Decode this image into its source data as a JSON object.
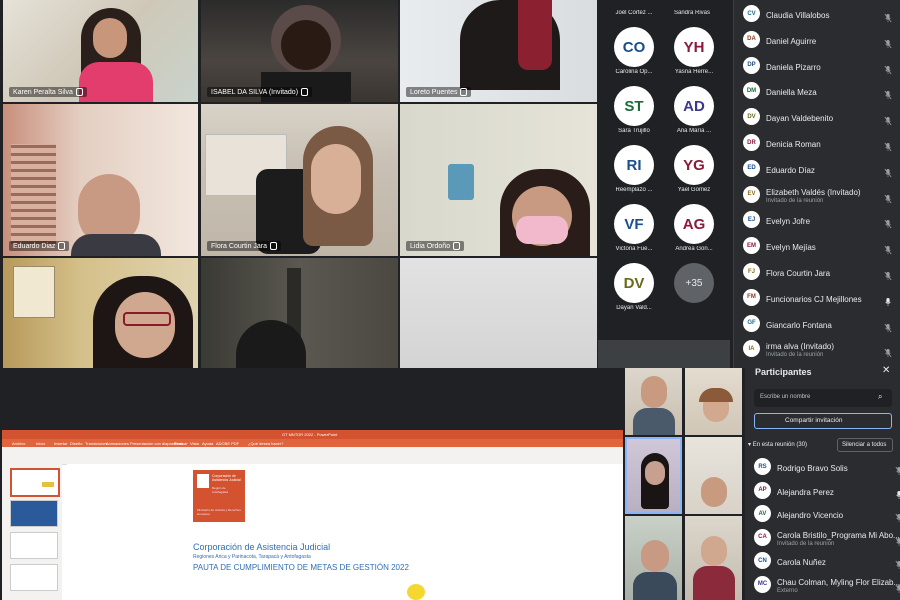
{
  "grid_tiles": [
    {
      "name": "Karen Peralta Silva"
    },
    {
      "name": "ISABEL DA SILVA (Invitado)"
    },
    {
      "name": "Loreto Puentes"
    },
    {
      "name": "Eduardo Diaz"
    },
    {
      "name": "Flora Courtin Jara"
    },
    {
      "name": "Lidia Ordoño"
    },
    {
      "name": ""
    },
    {
      "name": ""
    },
    {
      "name": ""
    }
  ],
  "avatar_grid": [
    {
      "initials": "",
      "label": "Joël Cortez ...",
      "color": "#1a73e8"
    },
    {
      "initials": "",
      "label": "Sandra Rivas",
      "color": "#1a73e8"
    },
    {
      "initials": "CO",
      "label": "Carolina Op...",
      "color": "#1a4f8a"
    },
    {
      "initials": "YH",
      "label": "Yasna Herre...",
      "color": "#8a1a3a"
    },
    {
      "initials": "ST",
      "label": "Sara Trujillo",
      "color": "#1a6a3a"
    },
    {
      "initials": "AD",
      "label": "Ana María ...",
      "color": "#3a3a8a"
    },
    {
      "initials": "RI",
      "label": "Reemplazo ...",
      "color": "#1a4f8a"
    },
    {
      "initials": "YG",
      "label": "Yael Gomez",
      "color": "#8a1a3a"
    },
    {
      "initials": "VF",
      "label": "Victoria Fue...",
      "color": "#1a4f8a"
    },
    {
      "initials": "AG",
      "label": "Andrea Gon...",
      "color": "#8a1a3a"
    },
    {
      "initials": "DV",
      "label": "Dayan Vald...",
      "color": "#6a6a1a"
    },
    {
      "initials": "+35",
      "label": "",
      "color": "#e8eaed"
    }
  ],
  "top_list": [
    {
      "initials": "CV",
      "name": "Claudia Villalobos",
      "sub": "",
      "color": "#1a6a8a",
      "mic": "muted"
    },
    {
      "initials": "DA",
      "name": "Daniel Aguirre",
      "sub": "",
      "color": "#8a3a1a",
      "mic": "muted"
    },
    {
      "initials": "DP",
      "name": "Daniela Pizarro",
      "sub": "",
      "color": "#1a4f8a",
      "mic": "muted"
    },
    {
      "initials": "DM",
      "name": "Daniella Meza",
      "sub": "",
      "color": "#1a6a3a",
      "mic": "muted"
    },
    {
      "initials": "DV",
      "name": "Dayan Valdebenito",
      "sub": "",
      "color": "#6a6a1a",
      "mic": "muted"
    },
    {
      "initials": "DR",
      "name": "Denicia Roman",
      "sub": "",
      "color": "#8a1a3a",
      "mic": "muted"
    },
    {
      "initials": "ED",
      "name": "Eduardo Díaz",
      "sub": "",
      "color": "#1a4f8a",
      "mic": "muted"
    },
    {
      "initials": "EV",
      "name": "Elizabeth Valdés (Invitado)",
      "sub": "Invitado de la reunión",
      "color": "#8a6a1a",
      "mic": "muted"
    },
    {
      "initials": "EJ",
      "name": "Evelyn Jofre",
      "sub": "",
      "color": "#1a4f8a",
      "mic": "muted"
    },
    {
      "initials": "EM",
      "name": "Evelyn Mejías",
      "sub": "",
      "color": "#8a1a3a",
      "mic": "muted"
    },
    {
      "initials": "FJ",
      "name": "Flora Courtin Jara",
      "sub": "",
      "color": "#8a6a1a",
      "mic": "muted"
    },
    {
      "initials": "FM",
      "name": "Funcionarios CJ Mejillones",
      "sub": "",
      "color": "#8a3a1a",
      "mic": "on"
    },
    {
      "initials": "GF",
      "name": "Giancarlo Fontana",
      "sub": "",
      "color": "#1a6a8a",
      "mic": "muted"
    },
    {
      "initials": "IA",
      "name": "irma alva (Invitado)",
      "sub": "Invitado de la reunión",
      "color": "#8a6a1a",
      "mic": "muted"
    }
  ],
  "participants_panel": {
    "title": "Participantes",
    "search_placeholder": "Escribe un nombre",
    "share_invite": "Compartir invitación",
    "in_meeting": "En esta reunión (30)",
    "mute_all": "Silenciar a todos",
    "people": [
      {
        "initials": "RS",
        "name": "Rodrigo Bravo Solis",
        "sub": "",
        "color": "#1a4f8a",
        "mic": "muted"
      },
      {
        "initials": "AP",
        "name": "Alejandra Perez",
        "sub": "",
        "color": "#8a1a3a",
        "mic": "on"
      },
      {
        "initials": "AV",
        "name": "Alejandro Vicencio",
        "sub": "",
        "color": "#1a6a3a",
        "mic": "muted"
      },
      {
        "initials": "CA",
        "name": "Carola Bristilo_Programa Mi Abo...",
        "sub": "Invitado de la reunión",
        "color": "#8a1a3a",
        "mic": "muted"
      },
      {
        "initials": "CN",
        "name": "Carola Nuñez",
        "sub": "",
        "color": "#1a4f8a",
        "mic": "muted"
      },
      {
        "initials": "MC",
        "name": "Chau Colman, Myling Flor Elizab...",
        "sub": "Externo",
        "color": "#3a3a8a",
        "mic": "muted"
      }
    ]
  },
  "shared_ppt": {
    "titlebar": "OT MNTOR 2022 - PowerPoint",
    "menu": [
      "Archivo",
      "Inicio",
      "Insertar",
      "Diseño",
      "Transiciones",
      "Animaciones",
      "Presentación con diapositivas",
      "Revisar",
      "Vista",
      "Ayuda",
      "ADOBE PDF",
      "¿Qué desea hacer?"
    ],
    "logo_line1": "Corporación de Asistencia Judicial",
    "logo_line2": "Región de Antofagasta",
    "ministry": "Ministerio de Justicia y Derechos Humanos",
    "slide_title": "Corporación de Asistencia Judicial",
    "slide_subtitle": "Regiones Arica y Parinacota, Tarapacá y Antofagasta",
    "slide_heading": "PAUTA DE CUMPLIMIENTO DE METAS DE GESTIÓN 2022"
  },
  "colors": {
    "accent": "#8ab4f8",
    "ppt_red": "#d35230",
    "bg": "#202124",
    "panel": "#2b2c30"
  }
}
